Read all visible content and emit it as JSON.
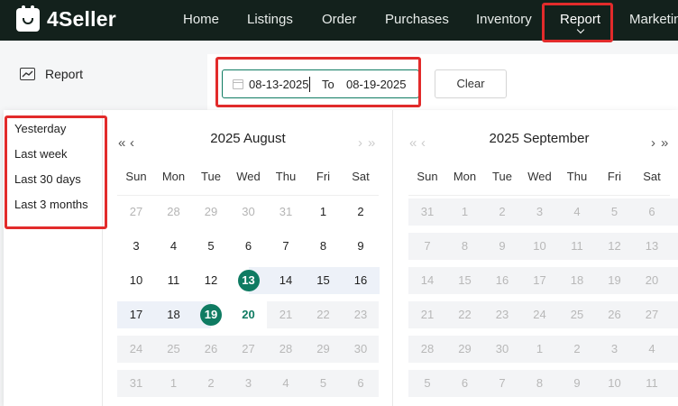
{
  "brand": {
    "name": "4Seller"
  },
  "nav": {
    "items": [
      "Home",
      "Listings",
      "Order",
      "Purchases",
      "Inventory",
      "Report",
      "Marketin"
    ],
    "active": "Report"
  },
  "sidebar": {
    "report_label": "Report"
  },
  "filter": {
    "start_date": "08-13-2025",
    "to_label": "To",
    "end_date": "08-19-2025",
    "clear_label": "Clear"
  },
  "picker": {
    "shortcuts": [
      "Yesterday",
      "Last week",
      "Last 30 days",
      "Last 3 months"
    ],
    "weekdays": [
      "Sun",
      "Mon",
      "Tue",
      "Wed",
      "Thu",
      "Fri",
      "Sat"
    ],
    "left": {
      "title": "2025 August",
      "weeks": [
        [
          "27",
          "28",
          "29",
          "30",
          "31",
          "1",
          "2"
        ],
        [
          "3",
          "4",
          "5",
          "6",
          "7",
          "8",
          "9"
        ],
        [
          "10",
          "11",
          "12",
          "13",
          "14",
          "15",
          "16"
        ],
        [
          "17",
          "18",
          "19",
          "20",
          "21",
          "22",
          "23"
        ],
        [
          "24",
          "25",
          "26",
          "27",
          "28",
          "29",
          "30"
        ],
        [
          "31",
          "1",
          "2",
          "3",
          "4",
          "5",
          "6"
        ]
      ]
    },
    "right": {
      "title": "2025 September",
      "weeks": [
        [
          "31",
          "1",
          "2",
          "3",
          "4",
          "5",
          "6"
        ],
        [
          "7",
          "8",
          "9",
          "10",
          "11",
          "12",
          "13"
        ],
        [
          "14",
          "15",
          "16",
          "17",
          "18",
          "19",
          "20"
        ],
        [
          "21",
          "22",
          "23",
          "24",
          "25",
          "26",
          "27"
        ],
        [
          "28",
          "29",
          "30",
          "1",
          "2",
          "3",
          "4"
        ],
        [
          "5",
          "6",
          "7",
          "8",
          "9",
          "10",
          "11"
        ]
      ]
    },
    "selected_start": "13",
    "selected_end": "19",
    "today": "20"
  },
  "colors": {
    "accent": "#0f7b62",
    "nav_bg": "#13211c",
    "highlight": "#e22b2b",
    "range_bg": "#edf1f8"
  }
}
